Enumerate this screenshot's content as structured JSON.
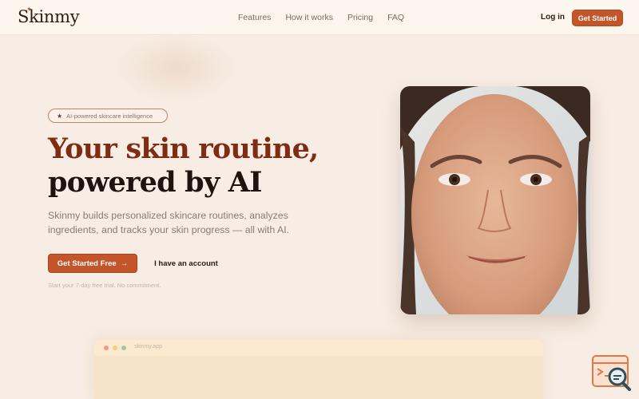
{
  "brand": {
    "name": "Skinmy",
    "accent": "#c2552a"
  },
  "nav": {
    "links": [
      "Features",
      "How it works",
      "Pricing",
      "FAQ"
    ],
    "login": "Log in",
    "cta": "Get Started"
  },
  "hero": {
    "badge": "AI-powered skincare intelligence",
    "badge_icon": "star-icon",
    "title_line1": "Your skin routine,",
    "title_line2": "powered by AI",
    "subtitle": "Skinmy builds personalized skincare routines, analyzes ingredients, and tracks your skin progress — all with AI.",
    "primary_button": "Get Started Free",
    "primary_icon": "arrow-right-icon",
    "secondary_button": "I have an account",
    "trial_note": "Start your 7-day free trial. No commitment."
  },
  "mockup": {
    "title": "skinmy.app"
  },
  "floating_widget": {
    "icon": "search-doc-icon"
  }
}
